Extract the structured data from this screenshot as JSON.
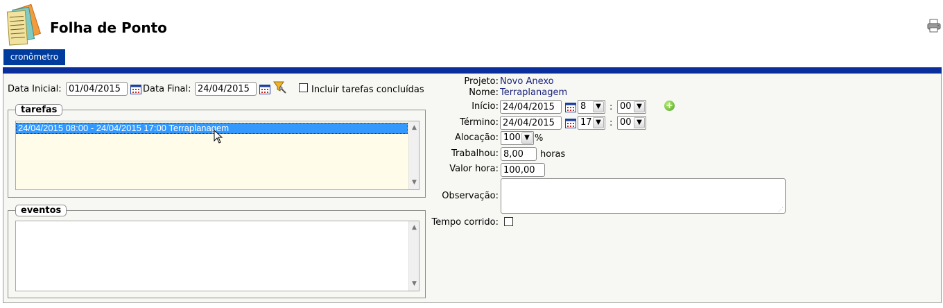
{
  "header": {
    "title": "Folha de Ponto"
  },
  "tabs": [
    {
      "label": "cronômetro"
    }
  ],
  "filters": {
    "data_inicial_label": "Data Inicial:",
    "data_inicial_value": "01/04/2015",
    "data_final_label": "Data Final:",
    "data_final_value": "24/04/2015",
    "incluir_label": "Incluir tarefas concluídas",
    "incluir_checked": false
  },
  "tarefas": {
    "legend": "tarefas",
    "items": [
      "24/04/2015 08:00 - 24/04/2015 17:00 Terraplanagem"
    ],
    "selected_index": 0
  },
  "eventos": {
    "legend": "eventos",
    "items": []
  },
  "details": {
    "projeto_label": "Projeto:",
    "projeto_value": "Novo Anexo",
    "nome_label": "Nome:",
    "nome_value": "Terraplanagem",
    "inicio_label": "Início:",
    "inicio_date": "24/04/2015",
    "inicio_hour": "8",
    "inicio_minute": "00",
    "termino_label": "Término:",
    "termino_date": "24/04/2015",
    "termino_hour": "17",
    "termino_minute": "00",
    "time_separator": ":",
    "alocacao_label": "Alocação:",
    "alocacao_value": "100",
    "alocacao_unit": "%",
    "trabalhou_label": "Trabalhou:",
    "trabalhou_value": "8,00",
    "trabalhou_unit": "horas",
    "valor_hora_label": "Valor hora:",
    "valor_hora_value": "100,00",
    "observacao_label": "Observação:",
    "observacao_value": "",
    "tempo_corrido_label": "Tempo corrido:",
    "tempo_corrido_checked": false
  },
  "icons": {
    "logo": "timesheet-cards-icon",
    "print": "printer-icon",
    "calendar": "calendar-icon",
    "filter": "filter-funnel-icon",
    "add": "add-circle-icon"
  },
  "colors": {
    "tab_bg": "#003c9e",
    "bar": "#0a2f9c",
    "selection": "#3399ff",
    "value_text": "#1a237e",
    "add_green": "#4aa12c"
  }
}
